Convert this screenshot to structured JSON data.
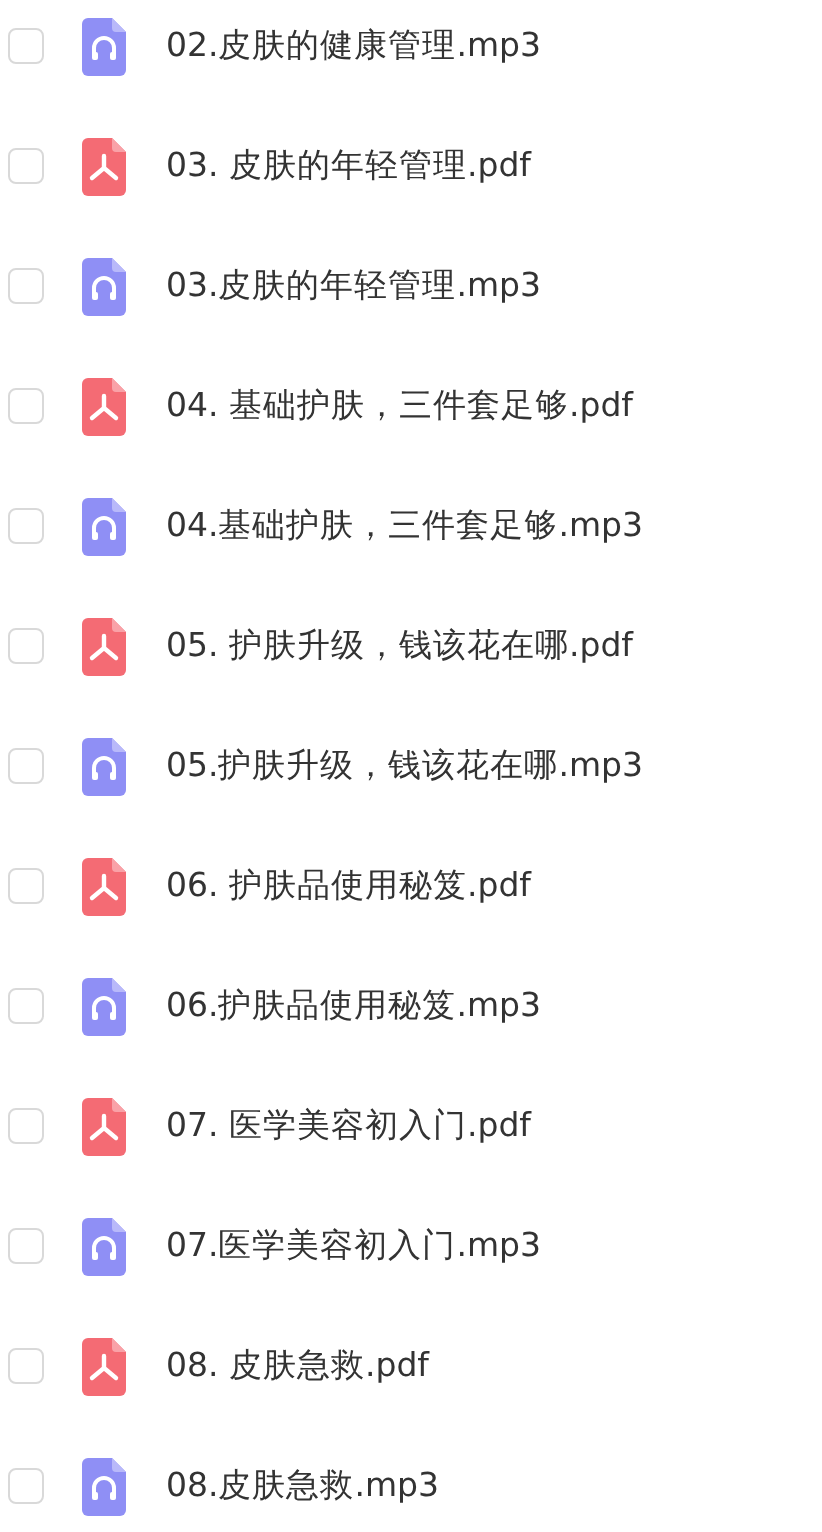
{
  "files": [
    {
      "name": "02.皮肤的健康管理.mp3",
      "kind": "audio",
      "checked": false
    },
    {
      "name": "03. 皮肤的年轻管理.pdf",
      "kind": "pdf",
      "checked": false
    },
    {
      "name": "03.皮肤的年轻管理.mp3",
      "kind": "audio",
      "checked": false
    },
    {
      "name": "04. 基础护肤，三件套足够.pdf",
      "kind": "pdf",
      "checked": false
    },
    {
      "name": "04.基础护肤，三件套足够.mp3",
      "kind": "audio",
      "checked": false
    },
    {
      "name": "05. 护肤升级，钱该花在哪.pdf",
      "kind": "pdf",
      "checked": false
    },
    {
      "name": "05.护肤升级，钱该花在哪.mp3",
      "kind": "audio",
      "checked": false
    },
    {
      "name": "06. 护肤品使用秘笈.pdf",
      "kind": "pdf",
      "checked": false
    },
    {
      "name": "06.护肤品使用秘笈.mp3",
      "kind": "audio",
      "checked": false
    },
    {
      "name": "07. 医学美容初入门.pdf",
      "kind": "pdf",
      "checked": false
    },
    {
      "name": "07.医学美容初入门.mp3",
      "kind": "audio",
      "checked": false
    },
    {
      "name": "08. 皮肤急救.pdf",
      "kind": "pdf",
      "checked": false
    },
    {
      "name": "08.皮肤急救.mp3",
      "kind": "audio",
      "checked": false
    }
  ]
}
